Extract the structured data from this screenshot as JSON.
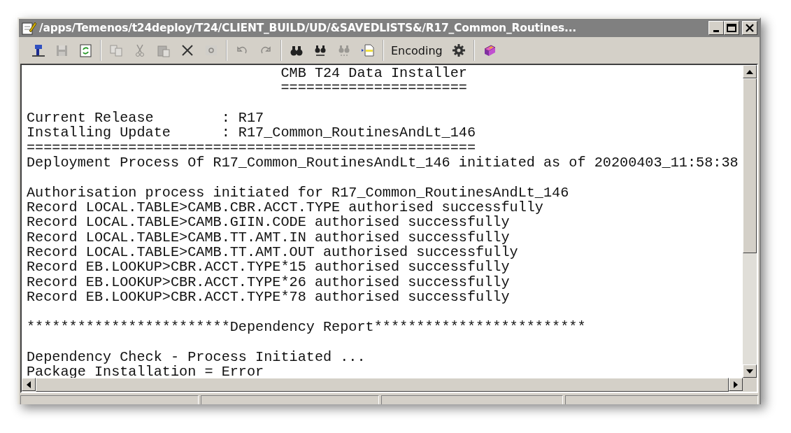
{
  "window": {
    "title": "/apps/Temenos/t24deploy/T24/CLIENT_BUILD/UD/&SAVEDLISTS&/R17_Common_Routines..."
  },
  "toolbar": {
    "groups": [
      [
        {
          "kind": "icon",
          "disabled": false
        },
        {
          "kind": "icon",
          "disabled": true
        },
        {
          "kind": "icon",
          "disabled": false
        }
      ],
      [
        {
          "kind": "icon",
          "disabled": true
        },
        {
          "kind": "icon",
          "disabled": true
        },
        {
          "kind": "icon",
          "disabled": true
        },
        {
          "kind": "icon",
          "disabled": false
        },
        {
          "kind": "icon",
          "disabled": true
        }
      ],
      [
        {
          "kind": "icon",
          "disabled": true
        },
        {
          "kind": "icon",
          "disabled": true
        }
      ],
      [
        {
          "kind": "icon",
          "disabled": false
        },
        {
          "kind": "icon",
          "disabled": false
        },
        {
          "kind": "icon",
          "disabled": true
        },
        {
          "kind": "icon",
          "disabled": false
        }
      ],
      [
        {
          "kind": "text",
          "label": "Encoding",
          "disabled": false
        },
        {
          "kind": "icon",
          "disabled": false
        }
      ],
      [
        {
          "kind": "icon",
          "disabled": false
        }
      ]
    ]
  },
  "output": {
    "blocks": [
      [
        "                              CMB T24 Data Installer",
        "                              ======================"
      ],
      [
        "Current Release        : R17",
        "Installing Update      : R17_Common_RoutinesAndLt_146",
        "=====================================================",
        "Deployment Process Of R17_Common_RoutinesAndLt_146 initiated as of 20200403_11:58:38"
      ],
      [
        "Authorisation process initiated for R17_Common_RoutinesAndLt_146",
        "Record LOCAL.TABLE>CAMB.CBR.ACCT.TYPE authorised successfully",
        "Record LOCAL.TABLE>CAMB.GIIN.CODE authorised successfully",
        "Record LOCAL.TABLE>CAMB.TT.AMT.IN authorised successfully",
        "Record LOCAL.TABLE>CAMB.TT.AMT.OUT authorised successfully",
        "Record EB.LOOKUP>CBR.ACCT.TYPE*15 authorised successfully",
        "Record EB.LOOKUP>CBR.ACCT.TYPE*26 authorised successfully",
        "Record EB.LOOKUP>CBR.ACCT.TYPE*78 authorised successfully"
      ],
      [
        "************************Dependency Report*************************"
      ],
      [
        "Dependency Check - Process Initiated ...",
        "Package Installation = Error"
      ]
    ]
  }
}
